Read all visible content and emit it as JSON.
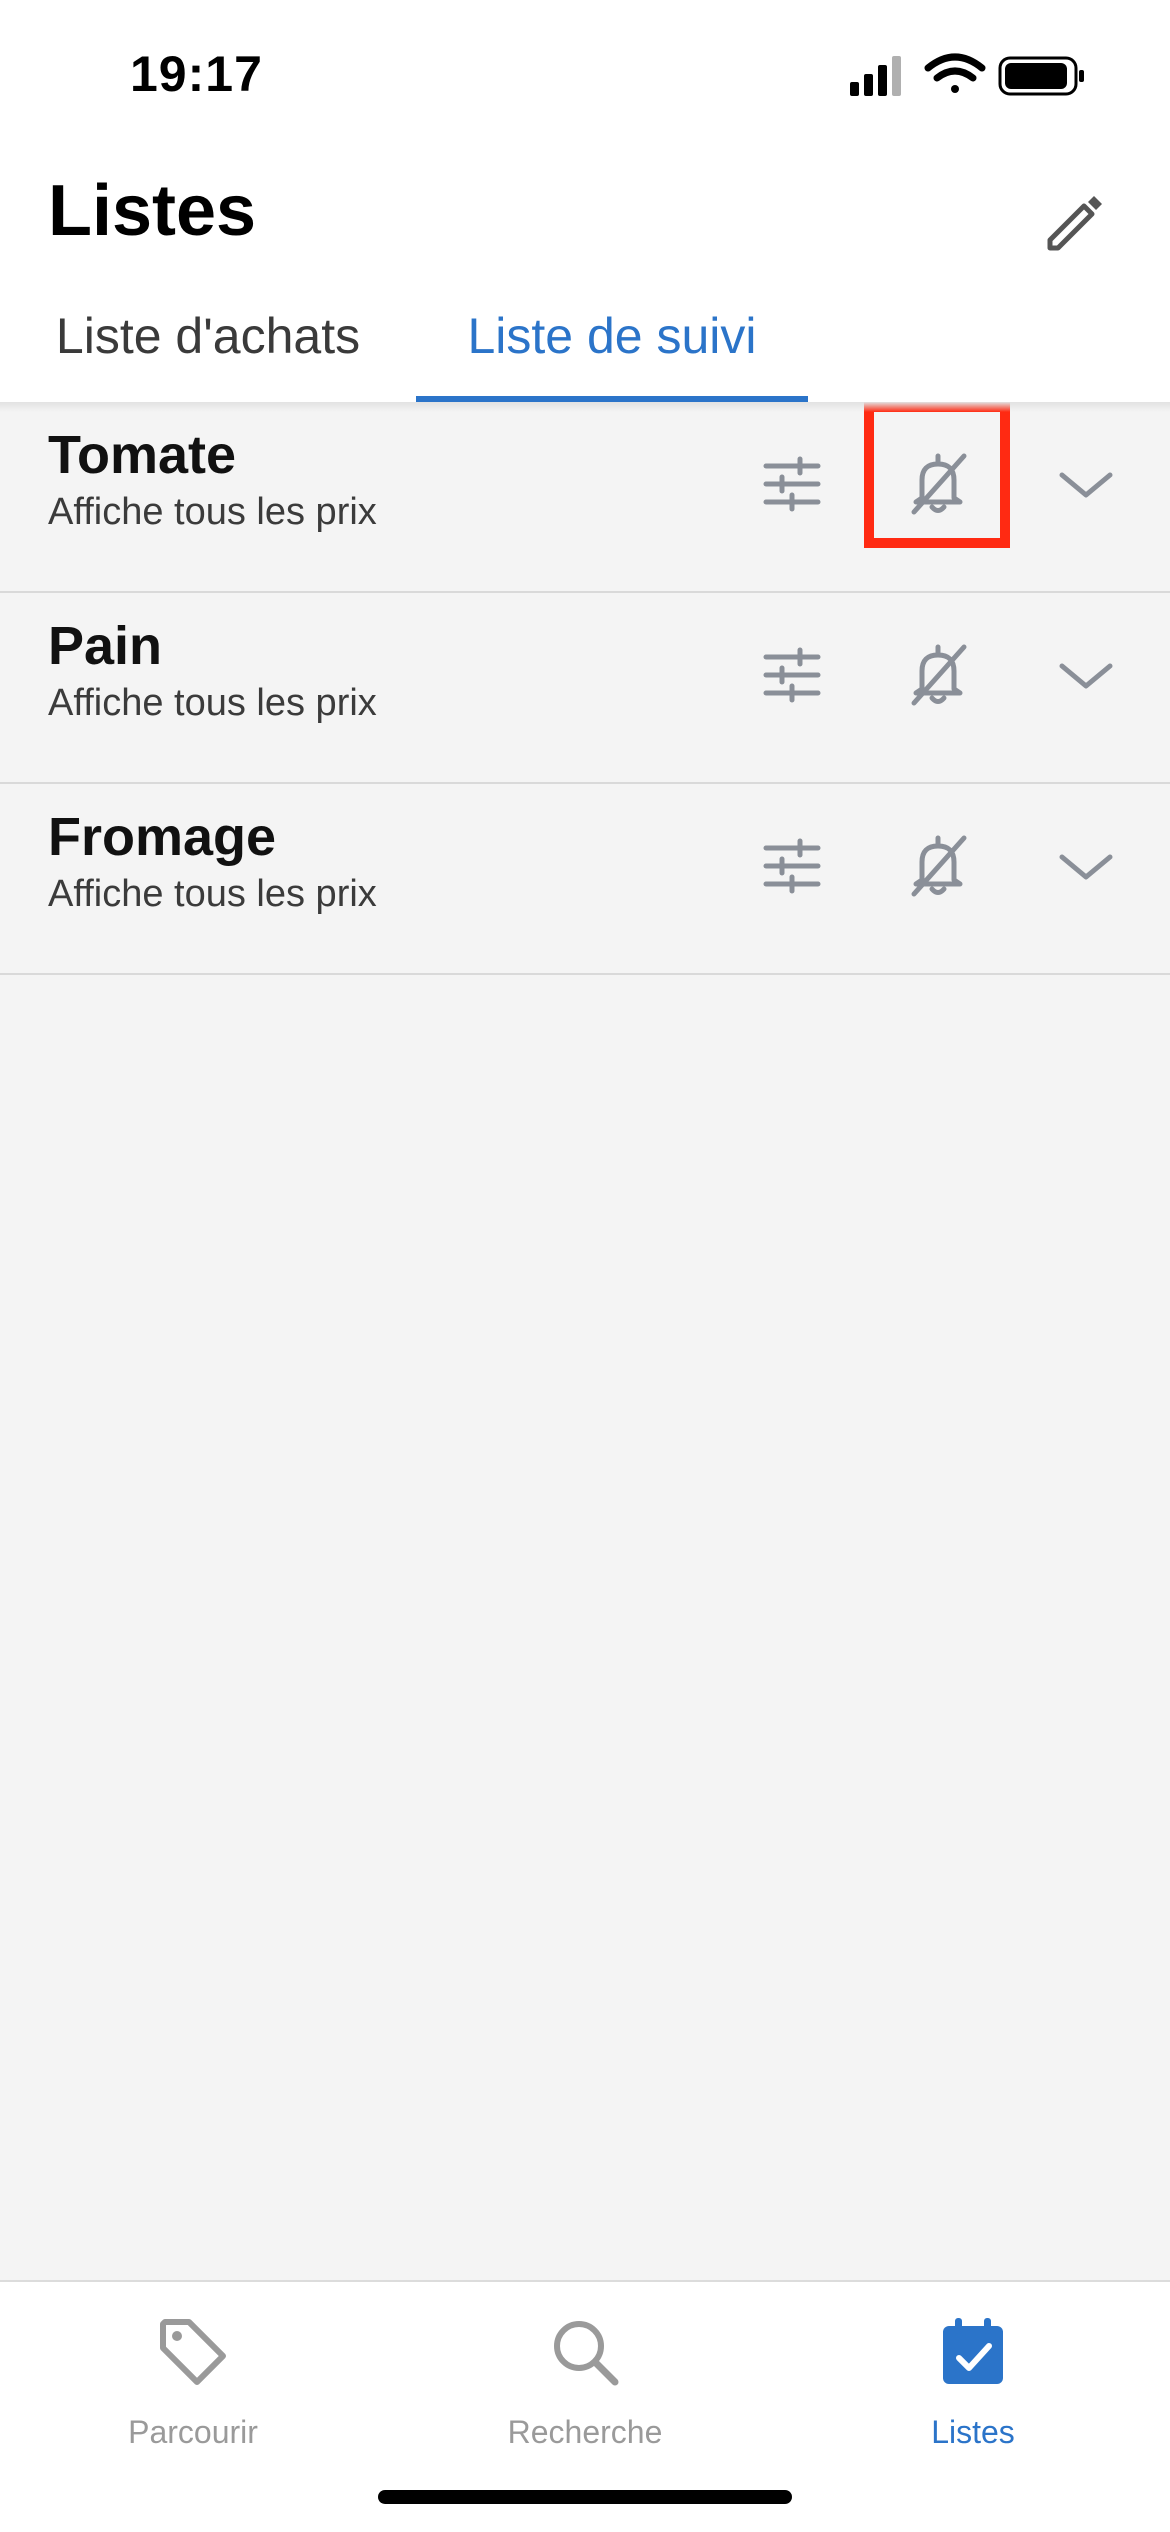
{
  "status_bar": {
    "time": "19:17"
  },
  "header": {
    "title": "Listes",
    "tabs": [
      {
        "label": "Liste d'achats",
        "active": false
      },
      {
        "label": "Liste de suivi",
        "active": true
      }
    ]
  },
  "watch_list": {
    "items": [
      {
        "name": "Tomate",
        "subtitle": "Affiche tous les prix"
      },
      {
        "name": "Pain",
        "subtitle": "Affiche tous les prix"
      },
      {
        "name": "Fromage",
        "subtitle": "Affiche tous les prix"
      }
    ]
  },
  "bottom_nav": {
    "items": [
      {
        "label": "Parcourir",
        "icon": "tag-icon",
        "active": false
      },
      {
        "label": "Recherche",
        "icon": "search-icon",
        "active": false
      },
      {
        "label": "Listes",
        "icon": "calendar-check-icon",
        "active": true
      }
    ]
  },
  "colors": {
    "accent": "#2b74c9",
    "icon_gray": "#8a8f98",
    "highlight": "#ff2a12"
  }
}
